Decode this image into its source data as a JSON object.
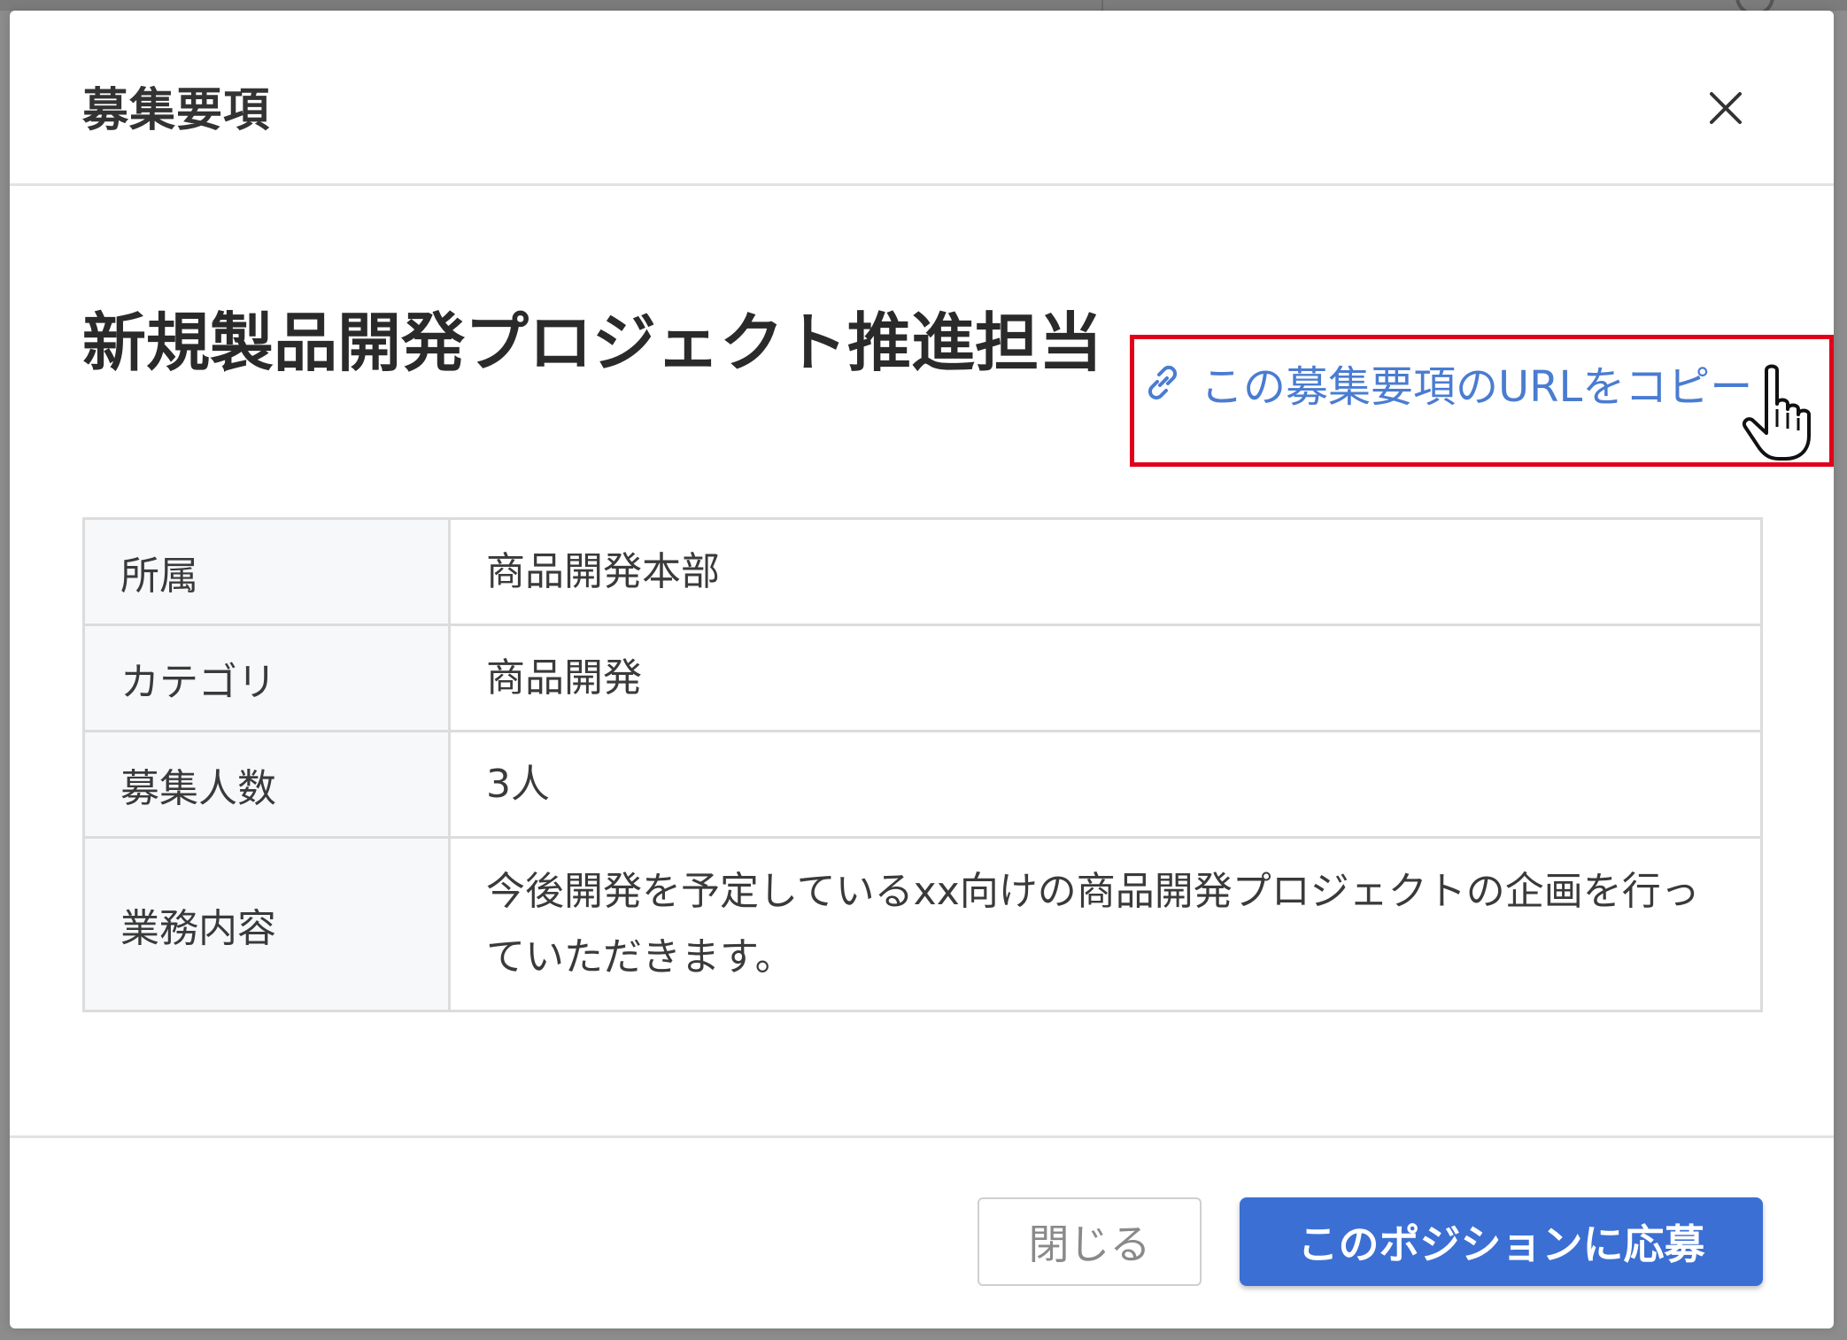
{
  "modal": {
    "title": "募集要項",
    "position_title": "新規製品開発プロジェクト推進担当",
    "copy_link_label": "この募集要項のURLをコピー",
    "details": [
      {
        "label": "所属",
        "value": "商品開発本部"
      },
      {
        "label": "カテゴリ",
        "value": "商品開発"
      },
      {
        "label": "募集人数",
        "value": "3人"
      },
      {
        "label": "業務内容",
        "value": "今後開発を予定しているxx向けの商品開発プロジェクトの企画を行っていただきます。"
      }
    ],
    "footer": {
      "close_label": "閉じる",
      "apply_label": "このポジションに応募"
    }
  },
  "colors": {
    "accent": "#3b6fd4",
    "link": "#4a7cd1",
    "highlight_border": "#e1001a"
  },
  "icons": [
    "close-icon",
    "link-icon",
    "hand-pointer-icon"
  ]
}
